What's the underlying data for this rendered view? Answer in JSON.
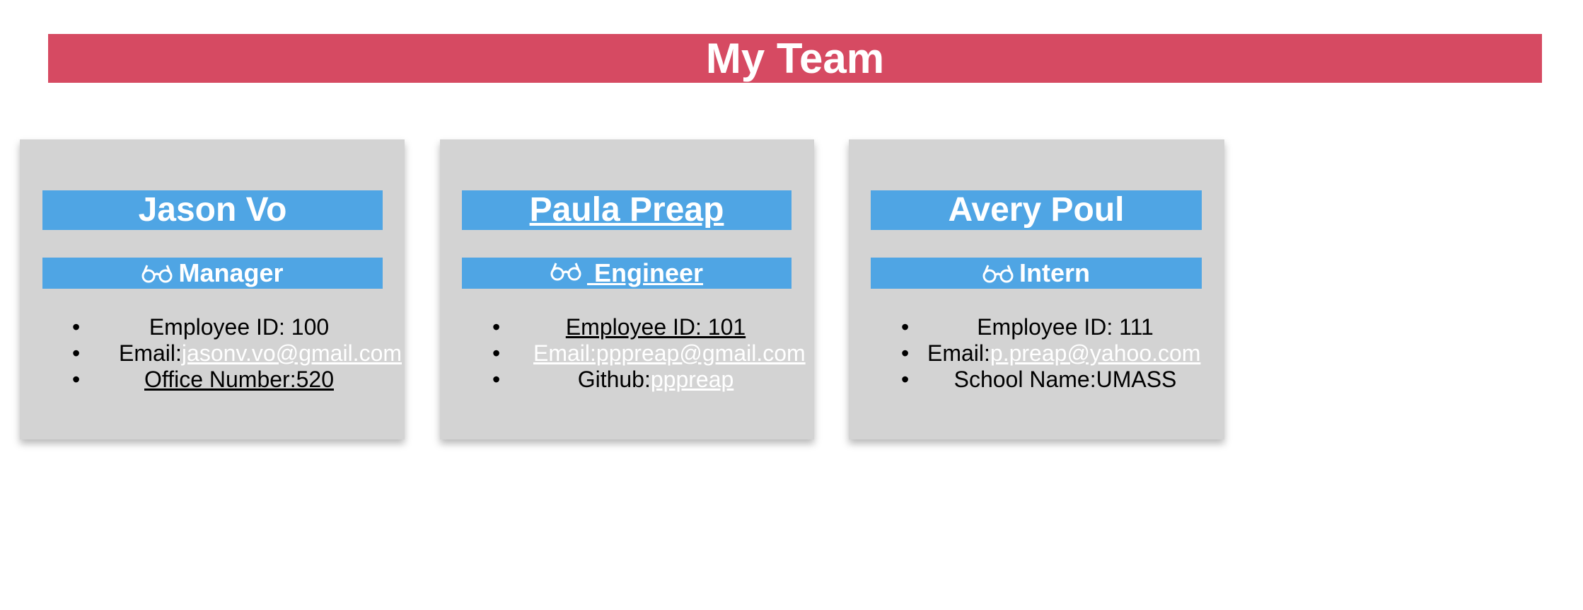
{
  "page": {
    "title": "My Team"
  },
  "icons": {
    "role_icon": "glasses-icon"
  },
  "colors": {
    "banner": "#d64a62",
    "header_bar": "#4fa5e4",
    "card": "#d3d3d3"
  },
  "cards": [
    {
      "name": "Jason Vo",
      "role": "Manager",
      "id_text": "Employee ID: 100",
      "email_label": "Email:",
      "email": "jasonv.vo@gmail.com",
      "extra_text": "Office Number:520"
    },
    {
      "name": "Paula Preap",
      "role": "Engineer",
      "id_text": "Employee ID: 101",
      "email_full": "Email:pppreap@gmail.com",
      "github_label": "Github:",
      "github": "pppreap"
    },
    {
      "name": "Avery Poul",
      "role": "Intern",
      "id_text": "Employee ID: 111",
      "email_label": "Email:",
      "email": "p.preap@yahoo.com",
      "extra_text": "School Name:UMASS"
    }
  ]
}
